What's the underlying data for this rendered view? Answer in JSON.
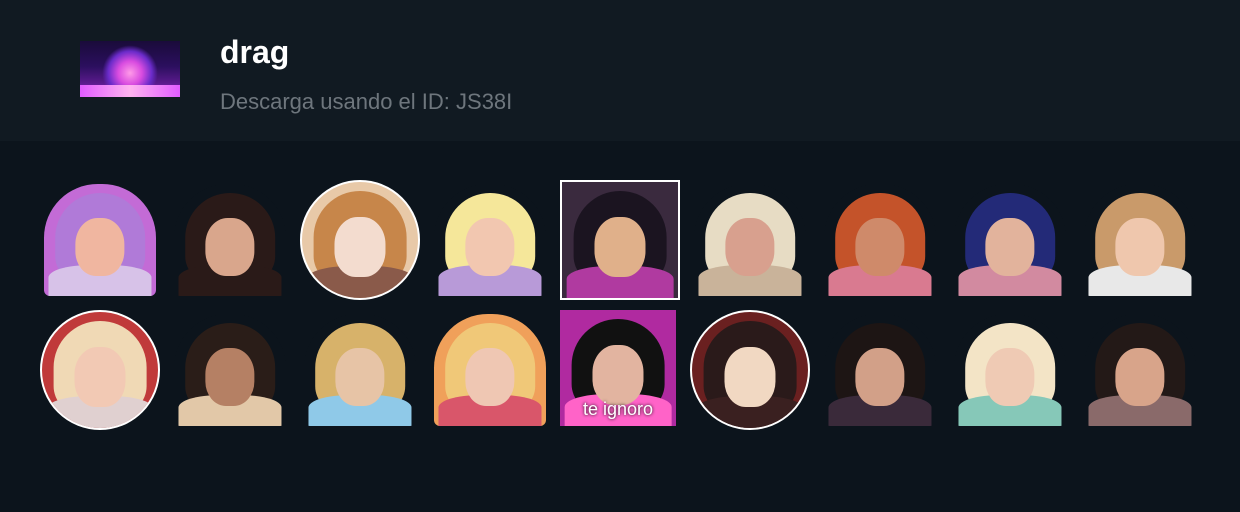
{
  "pack": {
    "title": "drag",
    "subtitle": "Descarga usando el ID: JS38I",
    "thumb_icon": "stage-lights-thumbnail"
  },
  "stickers": [
    {
      "name": "sticker-blonde-queen-gun",
      "shape": "cut",
      "bg": "#c36bd6",
      "hair": "#b07ad8",
      "skin": "#f0b6a0",
      "outfit": "#d7c2e8"
    },
    {
      "name": "sticker-surprised-queen",
      "shape": "cut",
      "bg": "#0c141c",
      "hair": "#2a1a18",
      "skin": "#d9a68c",
      "outfit": "#2a1a18"
    },
    {
      "name": "sticker-pale-makeup-queen",
      "shape": "circle",
      "bg": "#e8c9a8",
      "hair": "#c7864a",
      "skin": "#f3dccf",
      "outfit": "#8a5a4a"
    },
    {
      "name": "sticker-rainbow-hair-queen",
      "shape": "cut",
      "bg": "#0c141c",
      "hair": "#f5e79a",
      "skin": "#f2c7b0",
      "outfit": "#b89ad8"
    },
    {
      "name": "sticker-fan-queen",
      "shape": "square",
      "bg": "#3a2a3e",
      "hair": "#1b1420",
      "skin": "#e0b08a",
      "outfit": "#b03aa0"
    },
    {
      "name": "sticker-blonde-wig-queen",
      "shape": "cut",
      "bg": "#0c141c",
      "hair": "#e7dcc4",
      "skin": "#d8a08e",
      "outfit": "#c9b39a"
    },
    {
      "name": "sticker-steering-wheel-queen",
      "shape": "cut",
      "bg": "#0c141c",
      "hair": "#c4532a",
      "skin": "#cf8a6a",
      "outfit": "#d97a90"
    },
    {
      "name": "sticker-crying-blue-hair-queen",
      "shape": "cut",
      "bg": "#0c141c",
      "hair": "#232a78",
      "skin": "#e2b39c",
      "outfit": "#d28aa0"
    },
    {
      "name": "sticker-smiling-woman-gun",
      "shape": "cut",
      "bg": "#0c141c",
      "hair": "#c99a6a",
      "skin": "#efc7ad",
      "outfit": "#e8e8e8"
    },
    {
      "name": "sticker-kissing-queens",
      "shape": "circle",
      "bg": "#c03a3a",
      "hair": "#f0d9b5",
      "skin": "#f2c9b4",
      "outfit": "#e0d0d0"
    },
    {
      "name": "sticker-champagne-queen",
      "shape": "cut",
      "bg": "#0c141c",
      "hair": "#2a1d18",
      "skin": "#b58064",
      "outfit": "#e2c8a8"
    },
    {
      "name": "sticker-hat-pearls-queen",
      "shape": "cut",
      "bg": "#0c141c",
      "hair": "#d7b26a",
      "skin": "#e7c4a6",
      "outfit": "#8fc9e8"
    },
    {
      "name": "sticker-drinking-queen",
      "shape": "cut",
      "bg": "#f0a05a",
      "hair": "#f0c878",
      "skin": "#efc7b3",
      "outfit": "#d9566a"
    },
    {
      "name": "sticker-heart-glasses-queen",
      "shape": "square-plain",
      "bg": "#b02aa0",
      "hair": "#111111",
      "skin": "#e2b4a0",
      "outfit": "#ff63c8",
      "caption": "te ignoro"
    },
    {
      "name": "sticker-face-mask",
      "shape": "circle",
      "bg": "#6a2020",
      "hair": "#2a1a1a",
      "skin": "#f1d8c2",
      "outfit": "#3a2020"
    },
    {
      "name": "sticker-dark-hair-queen",
      "shape": "cut",
      "bg": "#0c141c",
      "hair": "#1d1514",
      "skin": "#d2a088",
      "outfit": "#3a2a3a"
    },
    {
      "name": "sticker-green-gloves-queen",
      "shape": "cut",
      "bg": "#0c141c",
      "hair": "#f3e4c6",
      "skin": "#efcab4",
      "outfit": "#86c8b8"
    },
    {
      "name": "sticker-smiling-queen-gun",
      "shape": "cut",
      "bg": "#0c141c",
      "hair": "#231917",
      "skin": "#d8a48a",
      "outfit": "#8a6a6a"
    }
  ]
}
